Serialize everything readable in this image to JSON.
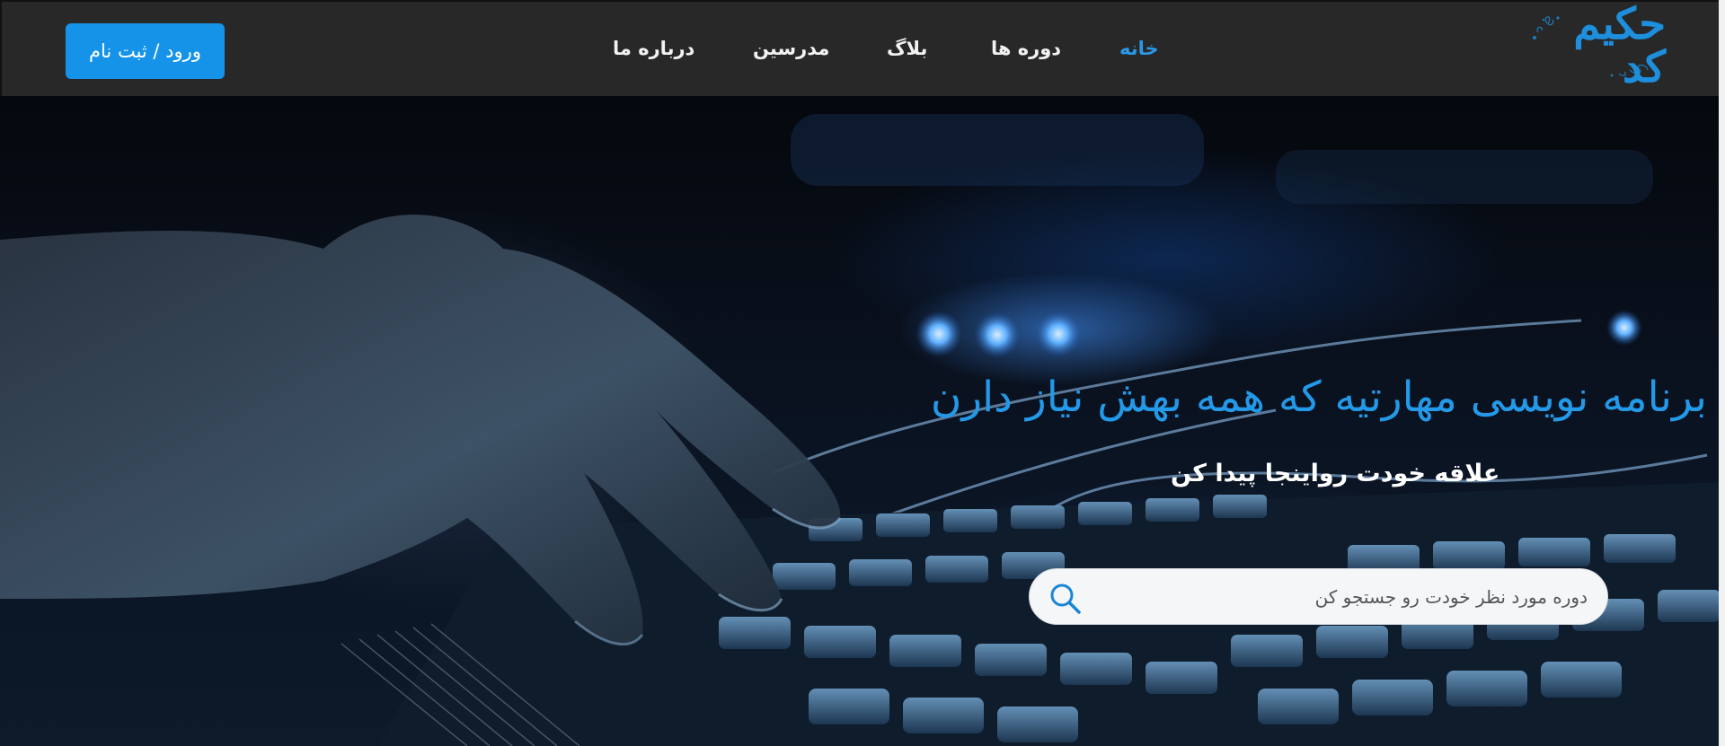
{
  "brand": {
    "logo_text": "حکیم کد",
    "logo_color": "#1d8fdc"
  },
  "nav": {
    "items": [
      {
        "label": "خانه",
        "active": true
      },
      {
        "label": "دوره ها",
        "active": false
      },
      {
        "label": "بلاگ",
        "active": false
      },
      {
        "label": "مدرسین",
        "active": false
      },
      {
        "label": "درباره ما",
        "active": false
      }
    ],
    "active_color": "#2a98e6"
  },
  "auth": {
    "login_label": "ورود / ثبت نام",
    "button_color": "#1593e8"
  },
  "hero": {
    "headline": "برنامه نویسی مهارتیه که همه بهش نیاز دارن",
    "subline": "علاقه خودت رواینجا پیدا کن",
    "search_placeholder": "دوره مورد نظر خودت رو جستجو کن",
    "search_value": "",
    "search_icon": "search-icon",
    "headline_color": "#2399e8"
  }
}
